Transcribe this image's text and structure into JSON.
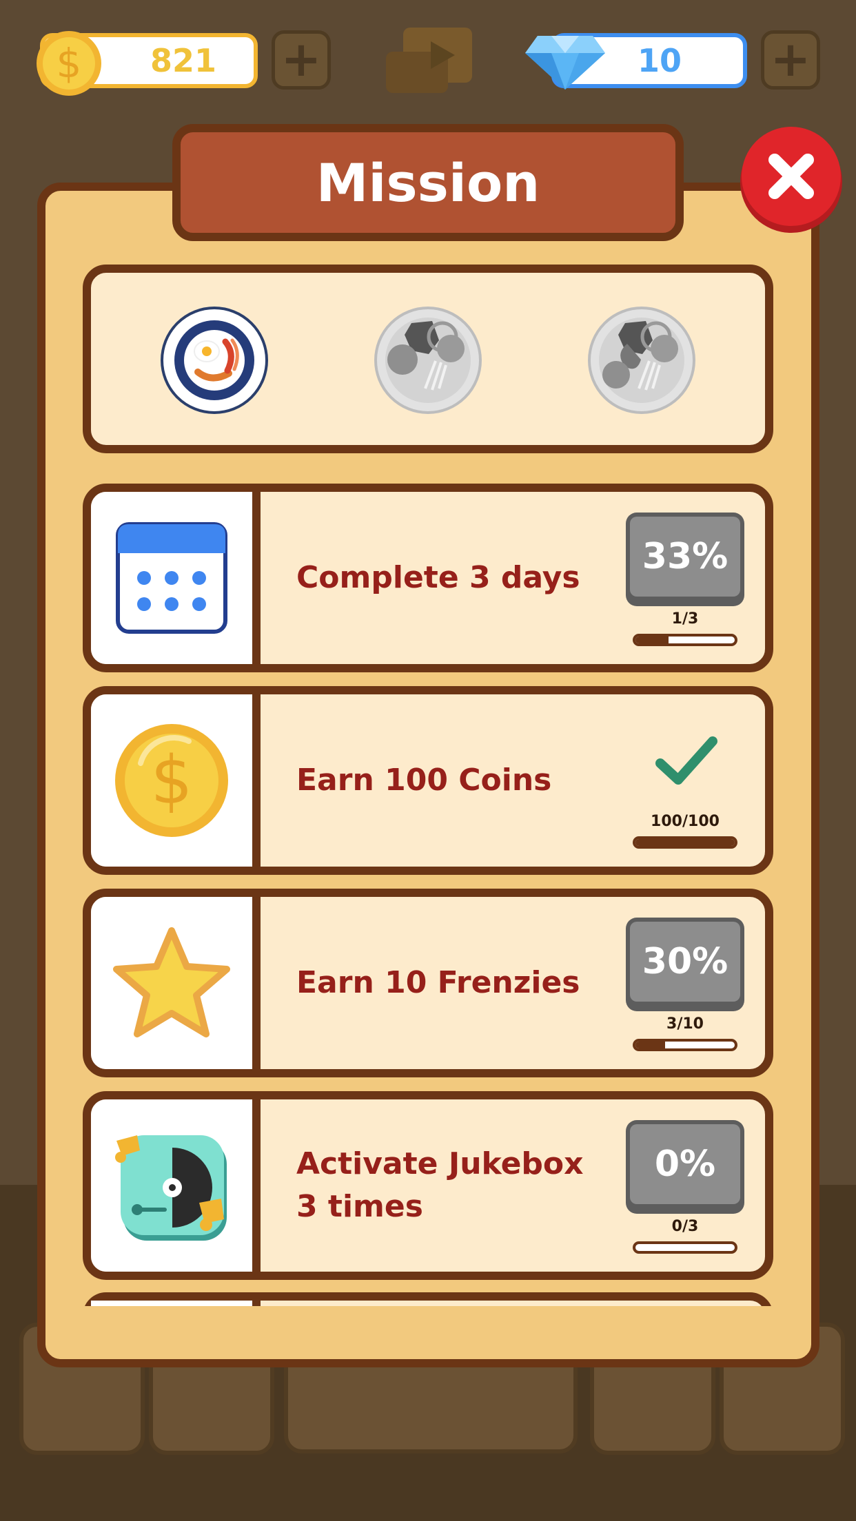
{
  "currency": {
    "coins": "821",
    "gems": "10"
  },
  "dialog": {
    "title": "Mission"
  },
  "plates": [
    {
      "name": "breakfast-plate",
      "state": "unlocked"
    },
    {
      "name": "locked-plate-1",
      "state": "locked"
    },
    {
      "name": "locked-plate-2",
      "state": "locked"
    }
  ],
  "missions": [
    {
      "label": "Complete 3 days",
      "percent": "33%",
      "progress": "1/3",
      "fraction": 0.33,
      "complete": false,
      "icon": "calendar-icon"
    },
    {
      "label": "Earn 100 Coins",
      "percent": "",
      "progress": "100/100",
      "fraction": 1.0,
      "complete": true,
      "icon": "coin-icon"
    },
    {
      "label": "Earn 10 Frenzies",
      "percent": "30%",
      "progress": "3/10",
      "fraction": 0.3,
      "complete": false,
      "icon": "star-icon"
    },
    {
      "label": "Activate Jukebox 3 times",
      "percent": "0%",
      "progress": "0/3",
      "fraction": 0.0,
      "complete": false,
      "icon": "jukebox-icon"
    }
  ],
  "colors": {
    "panel_border": "#6b3515",
    "title_bg": "#b05232",
    "label_text": "#96201a",
    "close_red": "#e0252a",
    "check_green": "#2f8f6c"
  }
}
